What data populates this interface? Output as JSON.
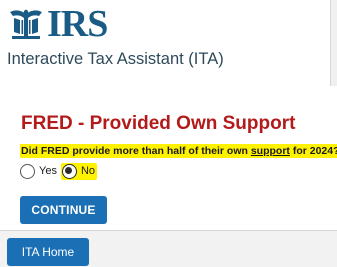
{
  "header": {
    "logo_text": "IRS",
    "logo_icon": "irs-eagle-logo",
    "app_title": "Interactive Tax Assistant (ITA)"
  },
  "question": {
    "title": "FRED - Provided Own Support",
    "text_before": "Did FRED provide more than half of their own ",
    "text_link": "support",
    "text_after": " for 2024?",
    "options": [
      {
        "label": "Yes",
        "selected": false
      },
      {
        "label": "No",
        "selected": true
      }
    ]
  },
  "actions": {
    "continue_label": "CONTINUE"
  },
  "footer": {
    "home_label": "ITA Home"
  },
  "colors": {
    "brand_blue": "#1a5b85",
    "button_blue": "#1a6fb5",
    "title_red": "#b31b1b",
    "highlight_yellow": "#fff200"
  }
}
